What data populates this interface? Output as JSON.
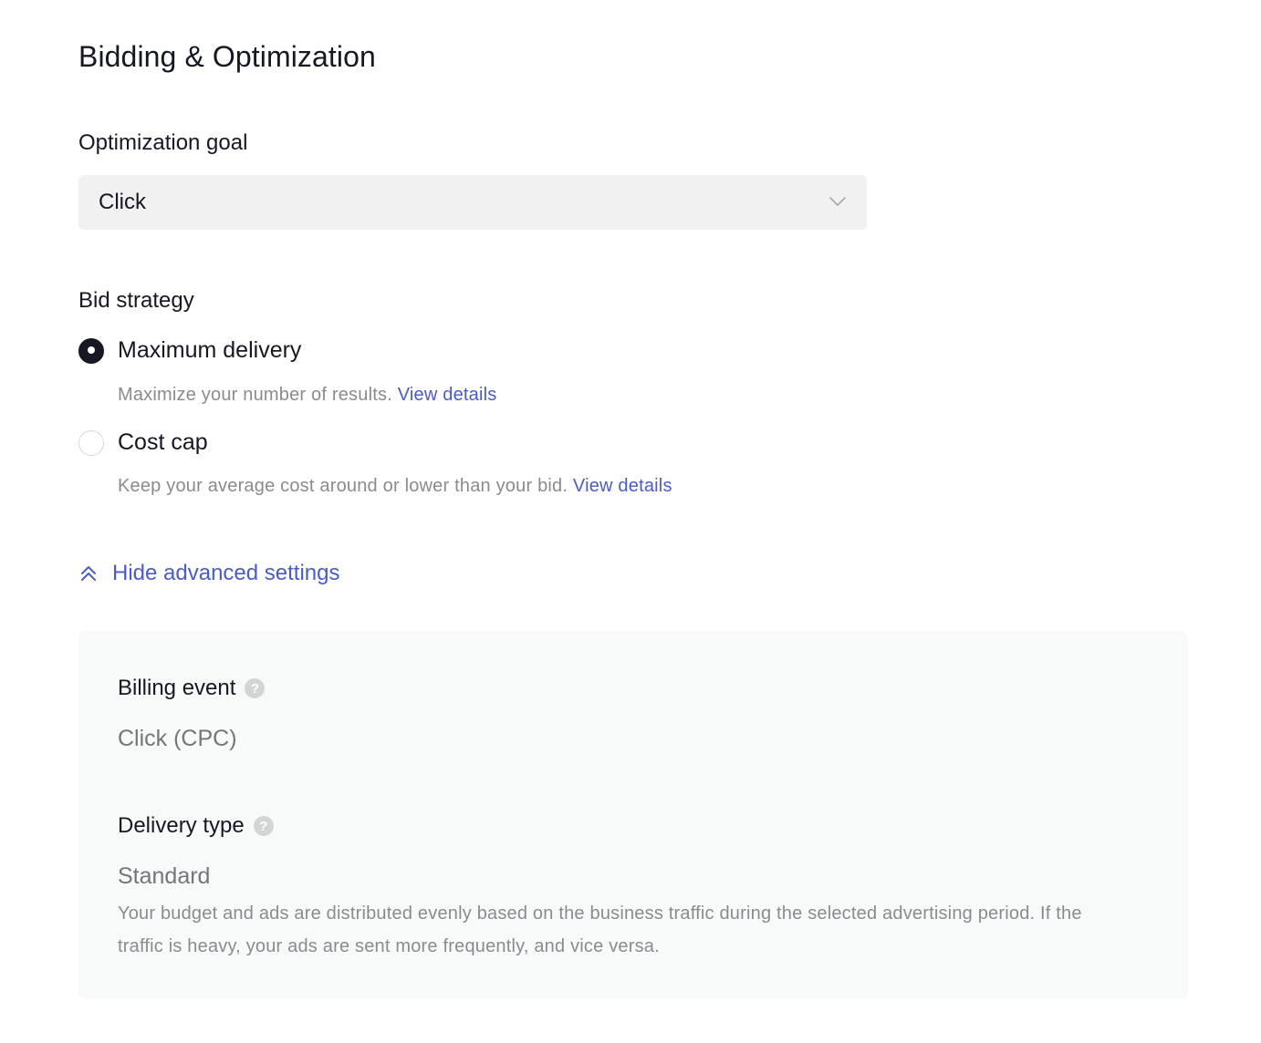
{
  "section": {
    "title": "Bidding & Optimization"
  },
  "optimization_goal": {
    "label": "Optimization goal",
    "selected": "Click"
  },
  "bid_strategy": {
    "label": "Bid strategy",
    "options": [
      {
        "label": "Maximum delivery",
        "checked": true,
        "description": "Maximize your number of results.",
        "link": "View details"
      },
      {
        "label": "Cost cap",
        "checked": false,
        "description": "Keep your average cost around or lower than your bid.",
        "link": "View details"
      }
    ]
  },
  "advanced_toggle": {
    "label": "Hide advanced settings",
    "icon": "double-chevron-up-icon"
  },
  "advanced": {
    "billing_event": {
      "label": "Billing event",
      "help": "?",
      "value": "Click (CPC)"
    },
    "delivery_type": {
      "label": "Delivery type",
      "help": "?",
      "value": "Standard",
      "description": "Your budget and ads are distributed evenly based on the business traffic during the selected advertising period. If the traffic is heavy, your ads are sent more frequently, and vice versa."
    }
  },
  "colors": {
    "text": "#161823",
    "secondary_text": "#8a8b91",
    "link": "#4b5bc9",
    "select_bg": "#f1f1f2",
    "panel_bg": "#f8f9f9"
  }
}
